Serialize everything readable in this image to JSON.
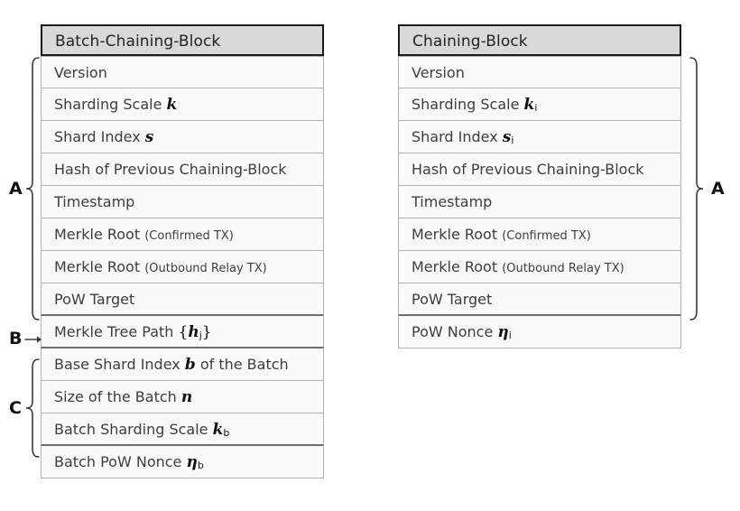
{
  "figure": {
    "type": "block-structure-diagram",
    "background": "#ffffff",
    "header_fill": "#d9d9d9",
    "row_fill": "#fafafa",
    "border_color": "#b3b3b3",
    "header_border_color": "#1a1a1a"
  },
  "blocks": [
    {
      "id": "batch-chaining-block",
      "title": "Batch-Chaining-Block",
      "rows": [
        {
          "label": "Version",
          "note": "",
          "symbol": "",
          "symbol_sub": "",
          "wrap": "none"
        },
        {
          "label": "Sharding Scale",
          "note": "",
          "symbol": "k",
          "symbol_sub": "",
          "wrap": "none"
        },
        {
          "label": "Shard Index",
          "note": "",
          "symbol": "s",
          "symbol_sub": "",
          "wrap": "none"
        },
        {
          "label": "Hash of Previous Chaining-Block",
          "note": "",
          "symbol": "",
          "symbol_sub": "",
          "wrap": "none"
        },
        {
          "label": "Timestamp",
          "note": "",
          "symbol": "",
          "symbol_sub": "",
          "wrap": "none"
        },
        {
          "label": "Merkle Root",
          "note": "(Confirmed TX)",
          "symbol": "",
          "symbol_sub": "",
          "wrap": "none"
        },
        {
          "label": "Merkle Root",
          "note": "(Outbound Relay TX)",
          "symbol": "",
          "symbol_sub": "",
          "wrap": "none"
        },
        {
          "label": "PoW Target",
          "note": "",
          "symbol": "",
          "symbol_sub": "",
          "wrap": "none"
        },
        {
          "label": "Merkle Tree Path",
          "note": "",
          "symbol": "h",
          "symbol_sub": "j",
          "wrap": "curly"
        },
        {
          "label": "Base Shard Index",
          "note": "",
          "symbol": "b",
          "symbol_sub": "",
          "suffix": "of the Batch",
          "wrap": "none"
        },
        {
          "label": "Size of the Batch",
          "note": "",
          "symbol": "n",
          "symbol_sub": "",
          "wrap": "none"
        },
        {
          "label": "Batch Sharding Scale",
          "note": "",
          "symbol": "k",
          "symbol_sub": "b",
          "wrap": "none"
        },
        {
          "label": "Batch PoW Nonce",
          "note": "",
          "symbol": "η",
          "symbol_sub": "b",
          "wrap": "none"
        }
      ],
      "group_separators_after_row_index": [
        7,
        8,
        11
      ]
    },
    {
      "id": "chaining-block",
      "title": "Chaining-Block",
      "rows": [
        {
          "label": "Version",
          "note": "",
          "symbol": "",
          "symbol_sub": "",
          "wrap": "none"
        },
        {
          "label": "Sharding Scale",
          "note": "",
          "symbol": "k",
          "symbol_sub": "i",
          "wrap": "none"
        },
        {
          "label": "Shard Index",
          "note": "",
          "symbol": "s",
          "symbol_sub": "i",
          "wrap": "none"
        },
        {
          "label": "Hash of Previous Chaining-Block",
          "note": "",
          "symbol": "",
          "symbol_sub": "",
          "wrap": "none"
        },
        {
          "label": "Timestamp",
          "note": "",
          "symbol": "",
          "symbol_sub": "",
          "wrap": "none"
        },
        {
          "label": "Merkle Root",
          "note": "(Confirmed TX)",
          "symbol": "",
          "symbol_sub": "",
          "wrap": "none"
        },
        {
          "label": "Merkle Root",
          "note": "(Outbound Relay TX)",
          "symbol": "",
          "symbol_sub": "",
          "wrap": "none"
        },
        {
          "label": "PoW Target",
          "note": "",
          "symbol": "",
          "symbol_sub": "",
          "wrap": "none"
        },
        {
          "label": "PoW Nonce",
          "note": "",
          "symbol": "η",
          "symbol_sub": "i",
          "wrap": "none"
        }
      ],
      "group_separators_after_row_index": [
        7
      ]
    }
  ],
  "annotations": [
    {
      "id": "left-brace-a",
      "label": "A",
      "side": "left",
      "spans_rows": "1-8",
      "block": "batch-chaining-block"
    },
    {
      "id": "left-arrow-b",
      "label": "B",
      "side": "left",
      "spans_rows": "9",
      "block": "batch-chaining-block"
    },
    {
      "id": "left-brace-c",
      "label": "C",
      "side": "left",
      "spans_rows": "10-12",
      "block": "batch-chaining-block"
    },
    {
      "id": "right-brace-a",
      "label": "A",
      "side": "right",
      "spans_rows": "1-8",
      "block": "chaining-block"
    }
  ]
}
